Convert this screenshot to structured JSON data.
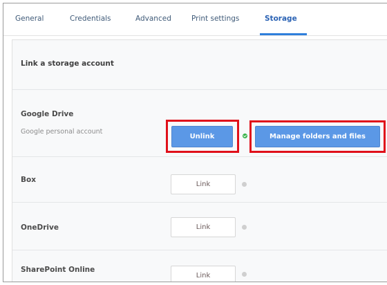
{
  "tabs": [
    {
      "label": "General"
    },
    {
      "label": "Credentials"
    },
    {
      "label": "Advanced"
    },
    {
      "label": "Print settings"
    },
    {
      "label": "Storage",
      "active": true
    }
  ],
  "storage": {
    "section_title": "Link a storage account",
    "services": [
      {
        "name": "Google Drive",
        "account": "Google personal account",
        "primary_button": "Unlink",
        "status": "linked",
        "manage_button": "Manage folders and files"
      },
      {
        "name": "Box",
        "button": "Link",
        "status": "unlinked"
      },
      {
        "name": "OneDrive",
        "button": "Link",
        "status": "unlinked"
      },
      {
        "name": "SharePoint Online",
        "button": "Link",
        "status": "unlinked"
      }
    ]
  },
  "colors": {
    "accent": "#2f7fdc",
    "primary_button": "#5b98e6",
    "highlight": "#e0101a",
    "status_ok": "#38b34a"
  }
}
